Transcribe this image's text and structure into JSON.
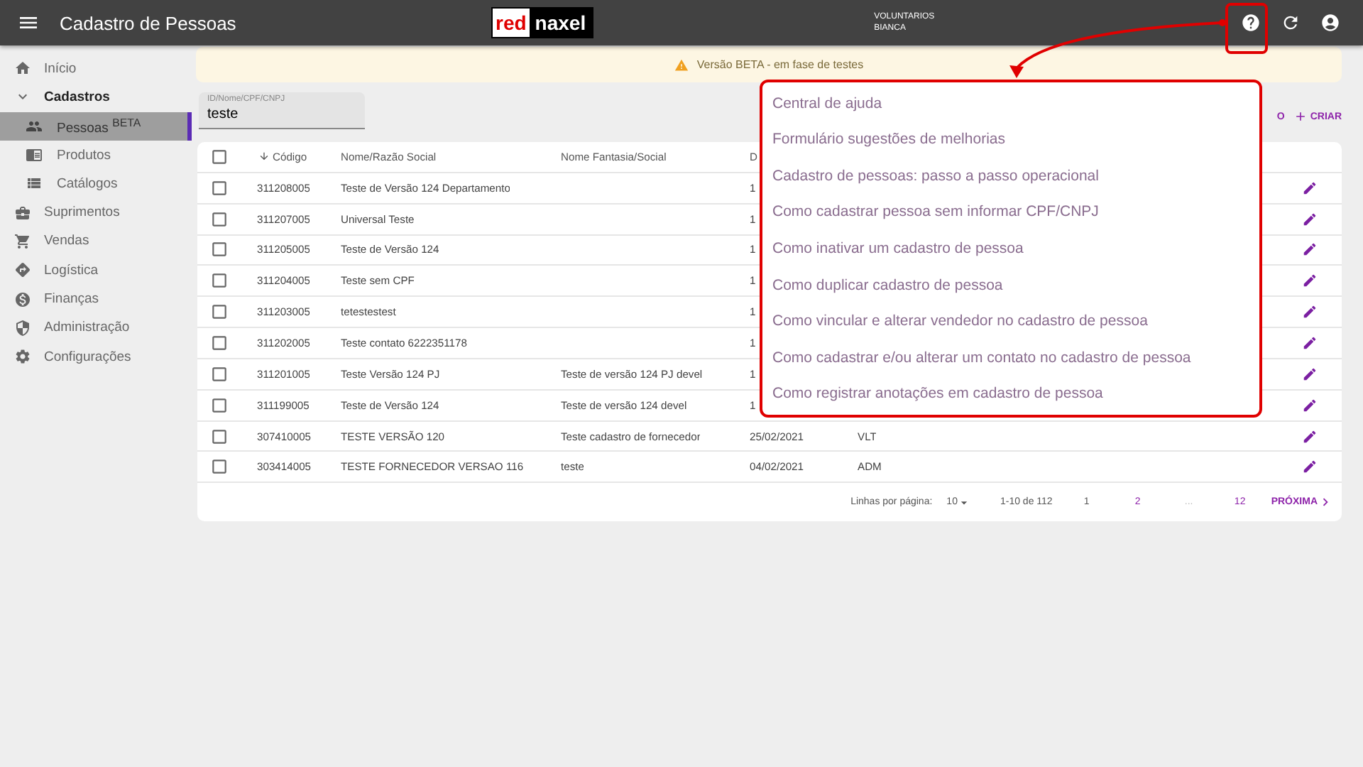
{
  "topbar": {
    "title": "Cadastro de Pessoas",
    "logo": {
      "part_1": "red",
      "part_2": "naxel"
    },
    "user": {
      "line_1": "VOLUNTARIOS",
      "line_2": "BIANCA"
    }
  },
  "sidebar": {
    "items": [
      {
        "label": "Início",
        "selected": false
      },
      {
        "label": "Cadastros",
        "selected": false,
        "expanded": true,
        "children": [
          {
            "label": "Pessoas $^{BETA}$",
            "selected": true
          },
          {
            "label": "Produtos",
            "selected": false
          },
          {
            "label": "Catálogos",
            "selected": false
          }
        ]
      },
      {
        "label": "Suprimentos",
        "selected": false
      },
      {
        "label": "Vendas",
        "selected": false
      },
      {
        "label": "Logística",
        "selected": false
      },
      {
        "label": "Finanças",
        "selected": false
      },
      {
        "label": "Administração",
        "selected": false
      },
      {
        "label": "Configurações",
        "selected": false
      }
    ]
  },
  "banner": {
    "text": "Versão BETA - em fase de testes"
  },
  "search": {
    "label": "ID/Nome/CPF/CNPJ",
    "value": "teste"
  },
  "actions": {
    "cut_button": "O",
    "create_button": "CRIAR"
  },
  "table": {
    "select_all_checked": false,
    "columns": [
      "Código",
      "Nome/Razão Social",
      "Nome Fantasia/Social",
      "D",
      ""
    ],
    "rows": [
      {
        "checked": false,
        "cells": [
          "311208005",
          "Teste de Versão 124 Departamento",
          "",
          "1",
          ""
        ]
      },
      {
        "checked": false,
        "cells": [
          "311207005",
          "Universal Teste",
          "",
          "1",
          ""
        ]
      },
      {
        "checked": false,
        "cells": [
          "311205005",
          "Teste de Versão 124",
          "",
          "1",
          ""
        ]
      },
      {
        "checked": false,
        "cells": [
          "311204005",
          "Teste sem CPF",
          "",
          "1",
          ""
        ]
      },
      {
        "checked": false,
        "cells": [
          "311203005",
          "tetestestest",
          "",
          "1",
          ""
        ]
      },
      {
        "checked": false,
        "cells": [
          "311202005",
          "Teste contato 6222351178",
          "",
          "1",
          ""
        ]
      },
      {
        "checked": false,
        "cells": [
          "311201005",
          "Teste Versão 124 PJ",
          "Teste de versão 124 PJ devel",
          "1",
          ""
        ]
      },
      {
        "checked": false,
        "cells": [
          "311199005",
          "Teste de Versão 124",
          "Teste de versão 124 devel",
          "1",
          ""
        ]
      },
      {
        "checked": false,
        "cells": [
          "307410005",
          "TESTE VERSÃO 120",
          "Teste cadastro de fornecedor",
          "25/02/2021",
          "VLT"
        ]
      },
      {
        "checked": false,
        "cells": [
          "303414005",
          "TESTE FORNECEDOR VERSAO 116",
          "teste",
          "04/02/2021",
          "ADM"
        ]
      }
    ]
  },
  "pagination": {
    "rows_label": "Linhas por página:",
    "rows_value": "10",
    "range": "1-10 de 112",
    "pages": [
      {
        "label": "1",
        "selected": true
      },
      {
        "label": "2",
        "selected": false
      },
      {
        "label": "...",
        "selected": false
      },
      {
        "label": "12",
        "selected": false
      }
    ],
    "next": "PRÓXIMA"
  },
  "help_menu": {
    "items": [
      "Central de ajuda",
      "Formulário sugestões de melhorias",
      "Cadastro de pessoas: passo a passo operacional",
      "Como cadastrar pessoa sem informar CPF/CNPJ",
      "Como inativar um cadastro de pessoa",
      "Como duplicar cadastro de pessoa",
      "Como vincular e alterar vendedor no cadastro de pessoa",
      "Como cadastrar e/ou alterar um contato no cadastro de pessoa",
      "Como registrar anotações em cadastro de pessoa"
    ]
  }
}
